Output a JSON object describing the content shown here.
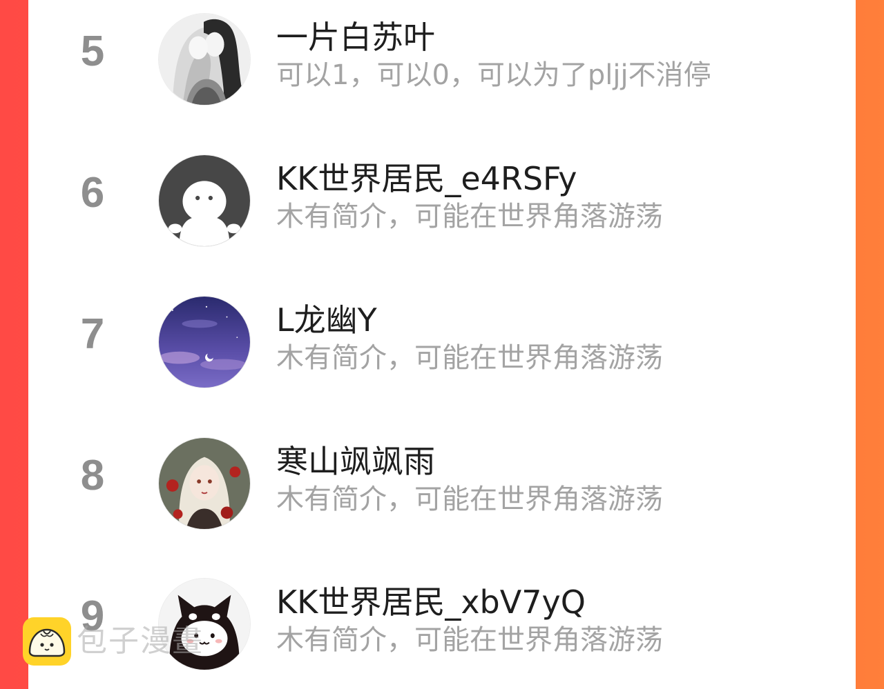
{
  "ranking": [
    {
      "rank": "5",
      "name": "一片白苏叶",
      "bio": "可以1，可以0，可以为了pljj不消停",
      "avatar_icon": "girls-illustration-avatar"
    },
    {
      "rank": "6",
      "name": "KK世界居民_e4RSFy",
      "bio": "木有简介，可能在世界角落游荡",
      "avatar_icon": "default-ghost-avatar"
    },
    {
      "rank": "7",
      "name": "L龙幽Y",
      "bio": "木有简介，可能在世界角落游荡",
      "avatar_icon": "night-sky-avatar"
    },
    {
      "rank": "8",
      "name": "寒山飒飒雨",
      "bio": "木有简介，可能在世界角落游荡",
      "avatar_icon": "anime-girl-flowers-avatar"
    },
    {
      "rank": "9",
      "name": "KK世界居民_xbV7yQ",
      "bio": "木有简介，可能在世界角落游荡",
      "avatar_icon": "black-cat-avatar"
    }
  ],
  "watermark": {
    "text": "包子漫畫",
    "icon": "baozi-bun-icon"
  },
  "colors": {
    "background_left": "#ff4a45",
    "background_right": "#ff7f3a",
    "card": "#ffffff",
    "rank_text": "#8e8e8e",
    "name_text": "#1e1e1e",
    "bio_text": "#a3a3a3",
    "watermark_logo": "#ffd329"
  }
}
